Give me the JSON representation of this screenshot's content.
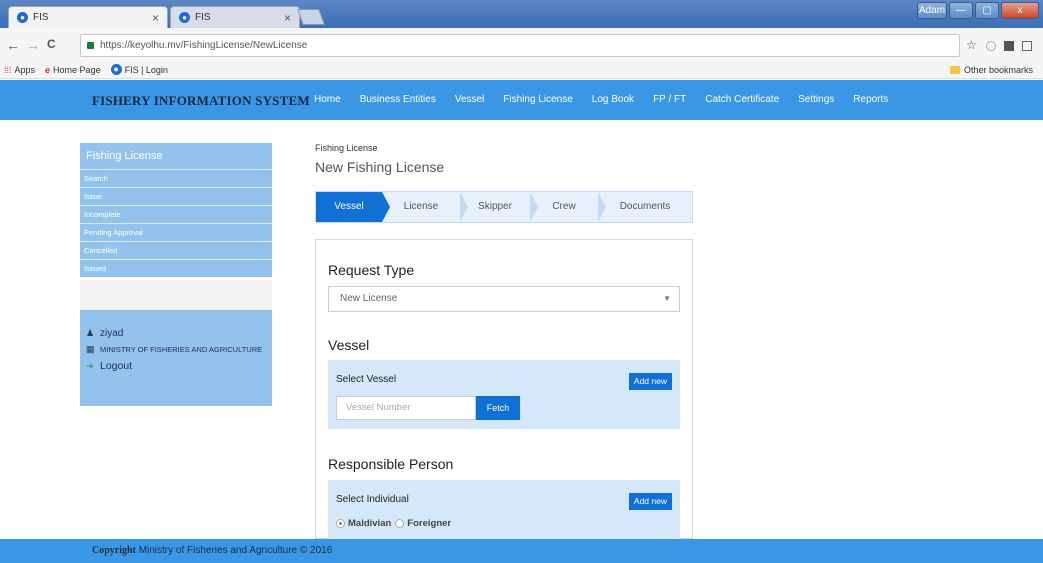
{
  "browser": {
    "tabs": [
      {
        "title": "FIS",
        "close": "×"
      },
      {
        "title": "FIS",
        "close": "×"
      }
    ],
    "window_user": "Adam",
    "window_buttons": {
      "minimize": "—",
      "maximize": "▢",
      "close": "x"
    },
    "nav": {
      "back": "←",
      "forward": "→",
      "reload": "C"
    },
    "url": "https://keyolhu.mv/FishingLicense/NewLicense",
    "bookmarks": [
      {
        "label": "Apps"
      },
      {
        "label": "Home Page"
      },
      {
        "label": "FIS | Login"
      }
    ],
    "other_bookmarks": "Other bookmarks",
    "toolbar_icons": {
      "star": "☆"
    }
  },
  "app": {
    "brand": "FISHERY INFORMATION SYSTEM",
    "menu": [
      "Home",
      "Business Entities",
      "Vessel",
      "Fishing License",
      "Log Book",
      "FP / FT",
      "Catch Certificate",
      "Settings",
      "Reports"
    ]
  },
  "sidebar": {
    "title": "Fishing License",
    "items": [
      "Search",
      "Issue",
      "Incomplete",
      "Pending Approval",
      "Cancelled",
      "Issued"
    ],
    "user_name": "ziyad",
    "org": "MINISTRY OF FISHERIES AND AGRICULTURE",
    "logout": "Logout"
  },
  "main": {
    "breadcrumb": "Fishing License",
    "title": "New Fishing License",
    "steps": [
      "Vessel",
      "License",
      "Skipper",
      "Crew",
      "Documents"
    ],
    "request_type": {
      "title": "Request Type",
      "selected": "New License",
      "caret": "▼"
    },
    "vessel": {
      "title": "Vessel",
      "label": "Select Vessel",
      "add_new": "Add new",
      "input_placeholder": "Vessel Number",
      "fetch": "Fetch"
    },
    "responsible": {
      "title": "Responsible Person",
      "label": "Select Individual",
      "add_new": "Add new",
      "options": [
        "Maldivian",
        "Foreigner"
      ]
    }
  },
  "footer": {
    "strong": "Copyright",
    "text": "Ministry of Fisheries and Agriculture © 2016"
  }
}
